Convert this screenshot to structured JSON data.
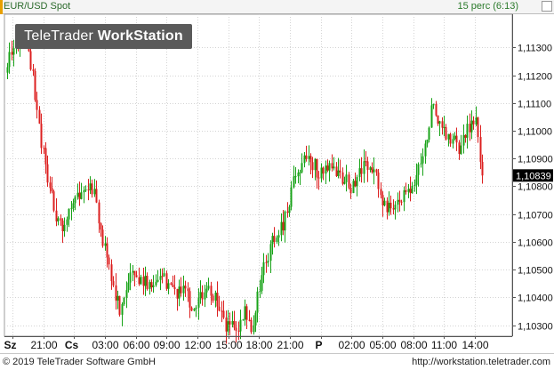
{
  "header": {
    "title": "EUR/USD Spot",
    "timeframe": "15 perc (6:13)"
  },
  "logo": {
    "text_normal": "TeleTrader ",
    "text_bold": "WorkStation"
  },
  "footer": {
    "copyright": "© 2019 TeleTrader Software GmbH",
    "url": "http://workstation.teletrader.com"
  },
  "colors": {
    "up": "#19a319",
    "down": "#dc2020",
    "grid": "#d4d4d4",
    "last_price_bg": "#000000"
  },
  "chart_data": {
    "type": "candlestick",
    "series_name": "EUR/USD Spot",
    "interval": "15 perc",
    "ylim": [
      1.1026,
      1.1142
    ],
    "y_ticks": [
      1.103,
      1.104,
      1.105,
      1.106,
      1.107,
      1.108,
      1.109,
      1.11,
      1.111,
      1.112,
      1.113
    ],
    "y_tick_labels": [
      "1,10300",
      "1,10400",
      "1,10500",
      "1,10600",
      "1,10700",
      "1,10800",
      "1,10900",
      "1,11000",
      "1,11100",
      "1,11200",
      "1,11300"
    ],
    "last_price": 1.10839,
    "last_price_label": "1,10839",
    "x_ticks": [
      {
        "label": "Sz",
        "bold": true,
        "day": true
      },
      {
        "label": "21:00"
      },
      {
        "label": "Cs",
        "bold": true,
        "day": true
      },
      {
        "label": "03:00"
      },
      {
        "label": "06:00"
      },
      {
        "label": "09:00"
      },
      {
        "label": "12:00"
      },
      {
        "label": "15:00"
      },
      {
        "label": "18:00"
      },
      {
        "label": "21:00"
      },
      {
        "label": "P",
        "bold": true,
        "day": true
      },
      {
        "label": "02:00"
      },
      {
        "label": "05:00"
      },
      {
        "label": "08:00"
      },
      {
        "label": "11:00"
      },
      {
        "label": "14:00"
      }
    ],
    "anchors": [
      1.1125,
      1.1128,
      1.1133,
      1.1131,
      1.1121,
      1.1102,
      1.1088,
      1.1078,
      1.1066,
      1.1064,
      1.1071,
      1.1076,
      1.1078,
      1.1079,
      1.1076,
      1.1064,
      1.1052,
      1.1042,
      1.1035,
      1.1044,
      1.1048,
      1.1046,
      1.1047,
      1.1044,
      1.1048,
      1.1046,
      1.1044,
      1.1042,
      1.1044,
      1.104,
      1.1036,
      1.104,
      1.1044,
      1.104,
      1.1035,
      1.103,
      1.1032,
      1.103,
      1.1034,
      1.1028,
      1.104,
      1.105,
      1.1058,
      1.1064,
      1.1066,
      1.1074,
      1.1084,
      1.1087,
      1.109,
      1.1088,
      1.1084,
      1.1086,
      1.1088,
      1.1085,
      1.1082,
      1.108,
      1.1084,
      1.1087,
      1.1088,
      1.1086,
      1.1072,
      1.1072,
      1.1074,
      1.1076,
      1.1079,
      1.1081,
      1.1086,
      1.1094,
      1.1112,
      1.1101,
      1.1099,
      1.1097,
      1.1094,
      1.1096,
      1.1102,
      1.1106,
      1.1084
    ],
    "seed": 20190613
  }
}
